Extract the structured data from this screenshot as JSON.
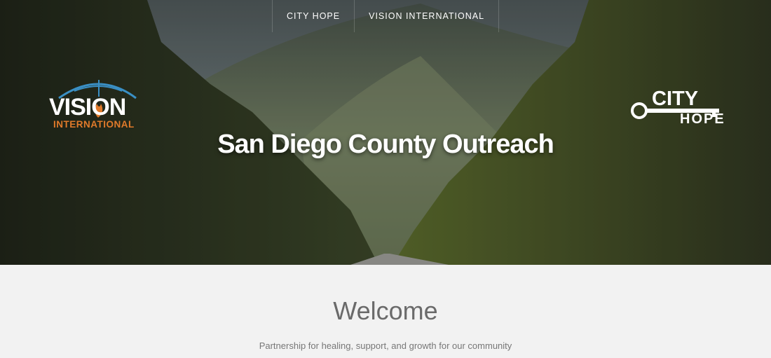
{
  "nav": {
    "items": [
      {
        "label": "CITY HOPE"
      },
      {
        "label": "VISION INTERNATIONAL"
      }
    ]
  },
  "hero": {
    "title": "San Diego County Outreach",
    "logo_left": {
      "word": "VISION",
      "sub": "INTERNATIONAL",
      "accent": "#e07a2a",
      "arc_color": "#3a8fc4"
    },
    "logo_right": {
      "word": "CITY",
      "sub": "HOPE",
      "icon": "key-icon"
    }
  },
  "welcome": {
    "heading": "Welcome",
    "tagline": "Partnership for healing, support, and growth for our community"
  }
}
